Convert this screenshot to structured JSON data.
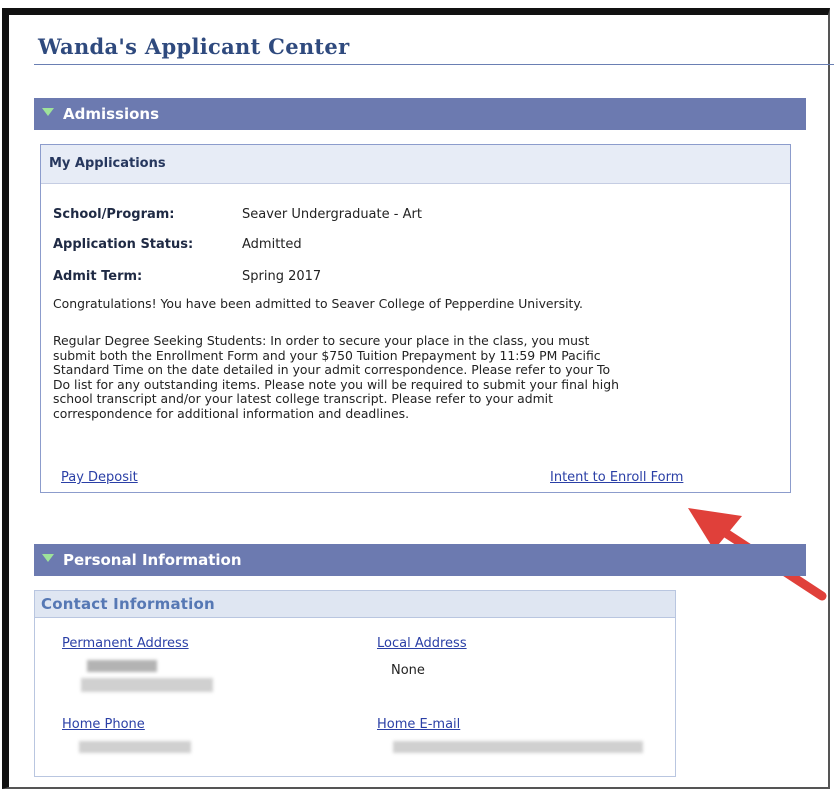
{
  "header": {
    "title": "Wanda's Applicant Center"
  },
  "admissions": {
    "section_title": "Admissions",
    "panel_title": "My Applications",
    "fields": [
      {
        "label": "School/Program:",
        "value": "Seaver Undergraduate - Art"
      },
      {
        "label": "Application Status:",
        "value": "Admitted"
      },
      {
        "label": "Admit Term:",
        "value": "Spring 2017"
      }
    ],
    "congrats": "Congratulations! You have been admitted to Seaver College of Pepperdine University.",
    "details_lines": [
      "Regular Degree Seeking Students:  In order to secure your place in the class, you must",
      "submit both the Enrollment Form and your $750 Tuition Prepayment by 11:59 PM Pacific",
      "Standard Time on the date detailed in your admit correspondence.  Please refer to your To",
      "Do list for any outstanding items.  Please note you will be required to submit your final high",
      "school transcript and/or your latest college transcript.  Please refer to your admit",
      "correspondence for additional information and deadlines."
    ],
    "pay_deposit_label": "Pay Deposit",
    "intent_form_label": "Intent to Enroll Form"
  },
  "personal": {
    "section_title": "Personal Information",
    "contact_title": "Contact Information",
    "permanent_address_label": "Permanent Address",
    "local_address_label": "Local Address",
    "local_address_value": "None",
    "home_phone_label": "Home Phone",
    "home_email_label": "Home E-mail"
  },
  "colors": {
    "section_bar": "#6c7ab0",
    "title": "#2f4a7e",
    "link": "#2a3fa6",
    "annotation_arrow": "#e0403a"
  }
}
